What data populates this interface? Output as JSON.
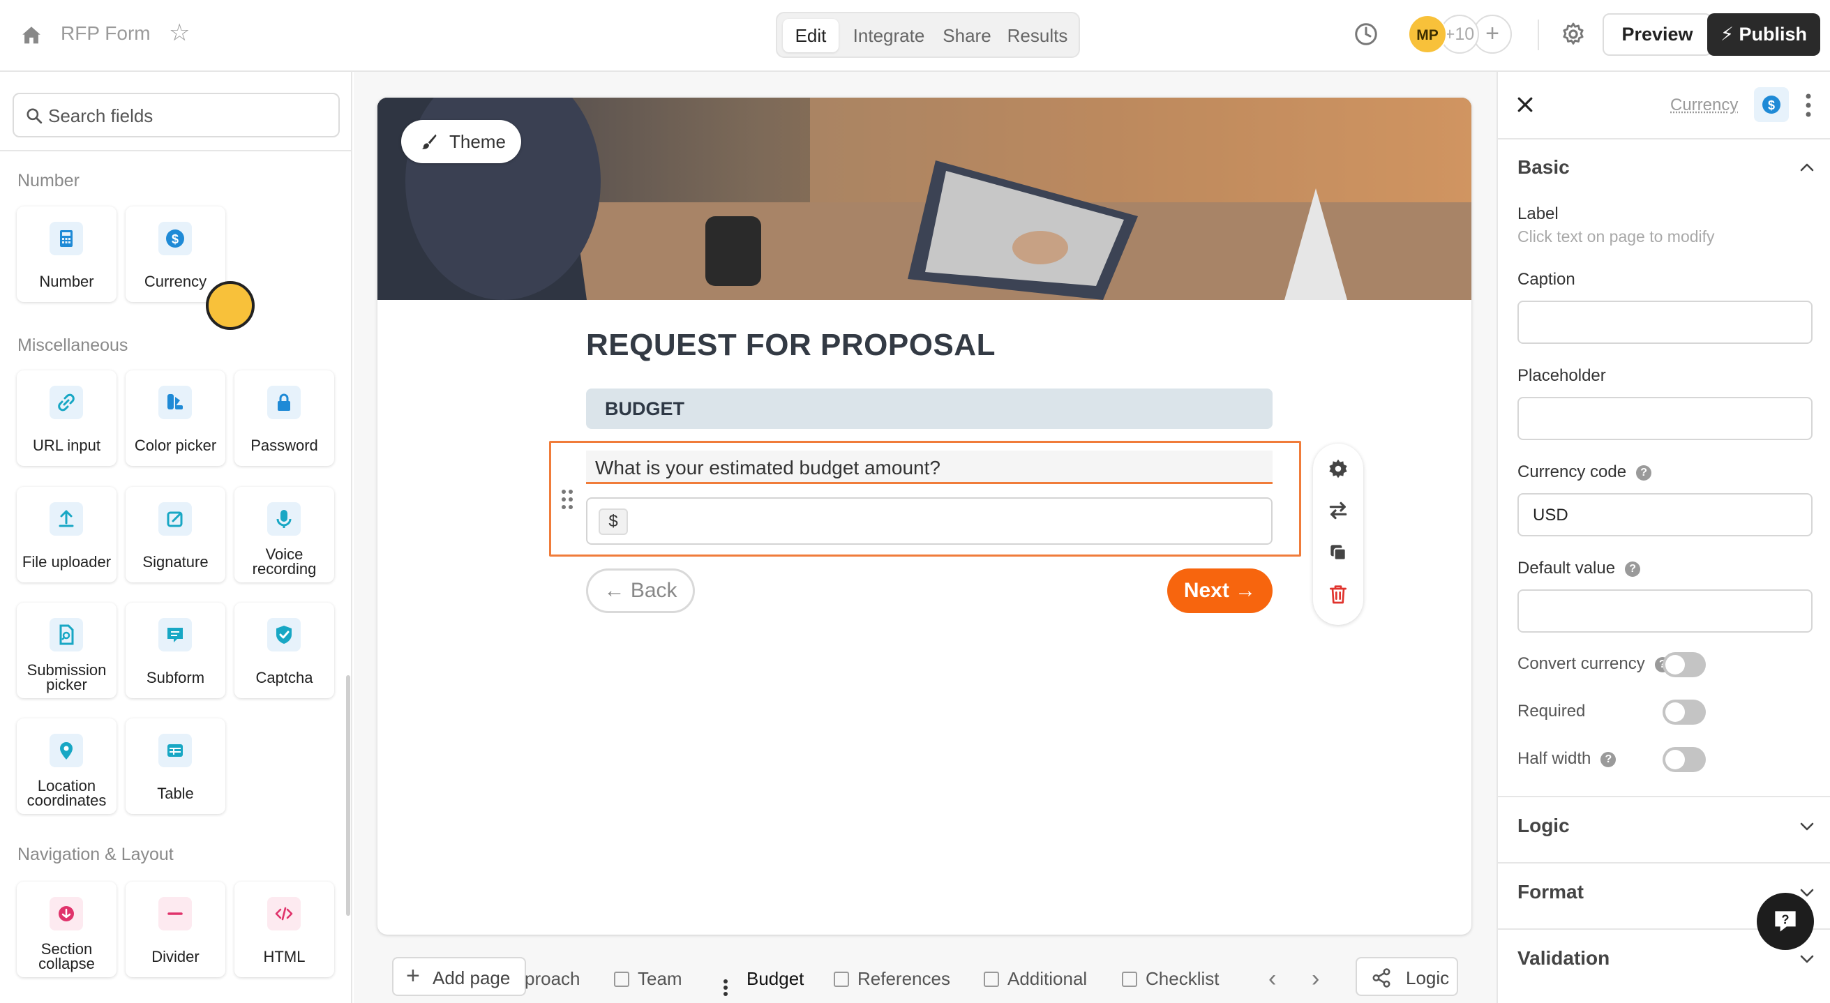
{
  "header": {
    "home_icon": "home-icon",
    "form_name": "RFP Form",
    "tabs": [
      "Edit",
      "Integrate",
      "Share",
      "Results"
    ],
    "active_tab": "Edit",
    "collaborator_initials": "MP",
    "more_collaborators": "+10",
    "add_collaborator": "+",
    "preview_label": "Preview",
    "publish_label": "Publish"
  },
  "sidebar": {
    "search_placeholder": "Search fields",
    "sections": [
      {
        "title": "Number",
        "items": [
          "Number",
          "Currency"
        ]
      },
      {
        "title": "Miscellaneous",
        "items": [
          "URL input",
          "Color picker",
          "Password",
          "File uploader",
          "Signature",
          "Voice recording",
          "Submission picker",
          "Subform",
          "Captcha",
          "Location coordinates",
          "Table"
        ]
      },
      {
        "title": "Navigation & Layout",
        "items": [
          "Section collapse",
          "Divider",
          "HTML"
        ]
      }
    ],
    "labels": {
      "number": "Number",
      "currency": "Currency",
      "url_input": "URL input",
      "color_picker": "Color picker",
      "password": "Password",
      "file_uploader": "File uploader",
      "signature": "Signature",
      "voice_1": "Voice",
      "voice_2": "recording",
      "submission_1": "Submission",
      "submission_2": "picker",
      "subform": "Subform",
      "captcha": "Captcha",
      "location_1": "Location",
      "location_2": "coordinates",
      "table": "Table",
      "section_collapse_1": "Section",
      "section_collapse_2": "collapse",
      "divider": "Divider",
      "html": "HTML"
    }
  },
  "canvas": {
    "theme_label": "Theme",
    "form_title": "REQUEST FOR PROPOSAL",
    "section_title": "BUDGET",
    "question": "What is your estimated budget amount?",
    "currency_prefix": "$",
    "back_label": "← Back",
    "next_label": "Next →"
  },
  "bottom_bar": {
    "add_page": "Add page",
    "pages": [
      "proach",
      "Team",
      "Budget",
      "References",
      "Additional",
      "Checklist"
    ],
    "active_page": "Budget",
    "logic_label": "Logic"
  },
  "right_panel": {
    "field_type": "Currency",
    "basic_title": "Basic",
    "label_title": "Label",
    "label_hint": "Click text on page to modify",
    "caption_title": "Caption",
    "caption_value": "",
    "placeholder_title": "Placeholder",
    "placeholder_value": "",
    "currency_code_title": "Currency code",
    "currency_code_value": "USD",
    "default_value_title": "Default value",
    "default_value": "",
    "convert_currency_title": "Convert currency",
    "convert_currency_on": false,
    "required_title": "Required",
    "required_on": false,
    "half_width_title": "Half width",
    "half_width_on": false,
    "logic_title": "Logic",
    "format_title": "Format",
    "validation_title": "Validation"
  },
  "colors": {
    "accent_orange": "#f7650e",
    "outline_orange": "#f07c3a",
    "icon_blue": "#1f8ad6",
    "icon_teal": "#18a7c4",
    "icon_pink": "#e0336b",
    "publish_bg": "#2a2a2a",
    "cursor_yellow": "#f8c13a"
  }
}
